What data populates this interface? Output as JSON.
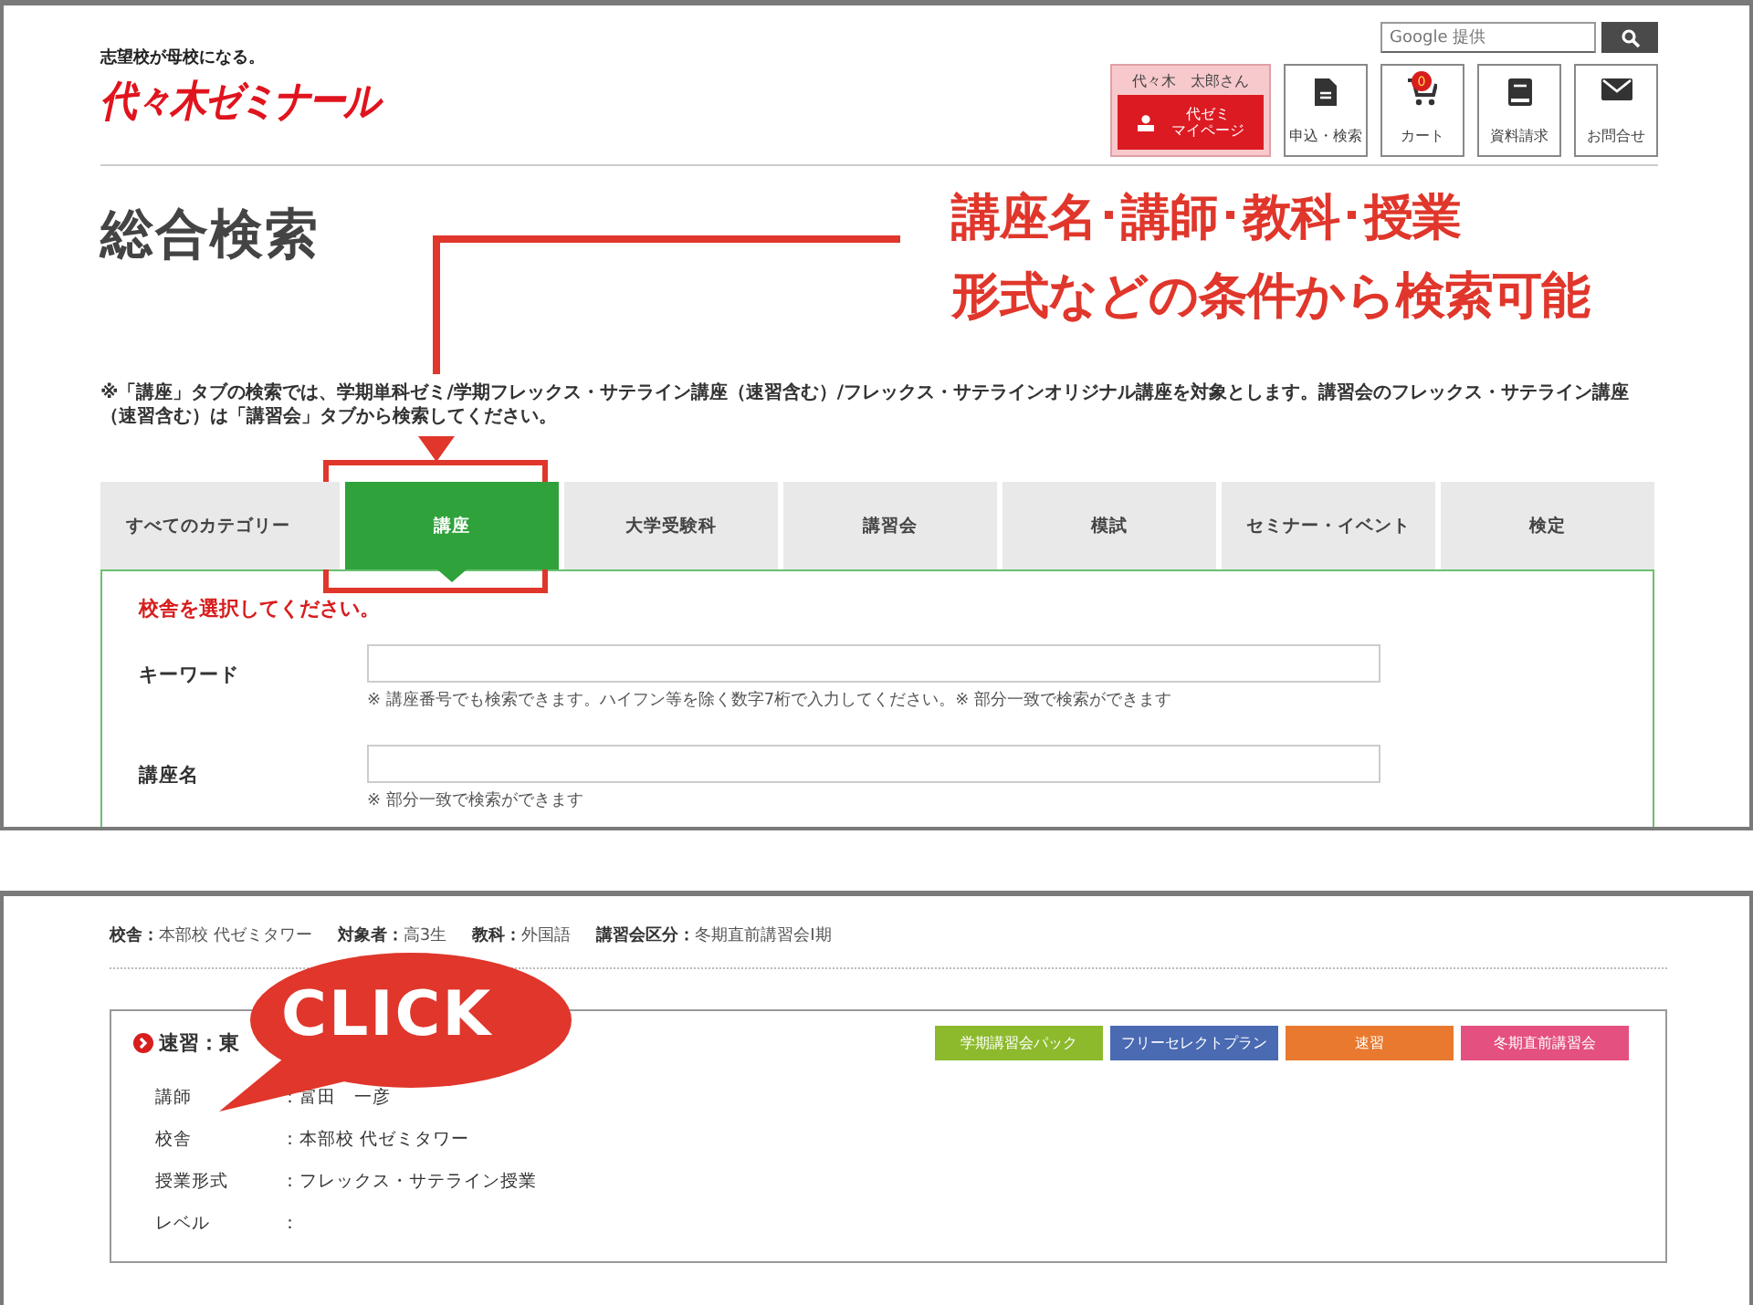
{
  "header": {
    "tagline": "志望校が母校になる。",
    "logo": "代々木ゼミナール",
    "search": {
      "placeholder": "Google 提供"
    },
    "user": {
      "name": "代々木　太郎さん",
      "mypage": [
        "代ゼミ",
        "マイページ"
      ]
    },
    "nav": [
      {
        "kind": "doc",
        "label": "申込・検索"
      },
      {
        "kind": "cart",
        "label": "カート",
        "badge": "0"
      },
      {
        "kind": "book",
        "label": "資料請求"
      },
      {
        "kind": "mail",
        "label": "お問合せ"
      }
    ]
  },
  "page_title": "総合検索",
  "annotation": {
    "lines": [
      "講座名･講師･教科･授業",
      "形式などの条件から検索可能"
    ],
    "click_label": "CLICK"
  },
  "notice": "※「講座」タブの検索では、学期単科ゼミ/学期フレックス・サテライン講座（速習含む）/フレックス・サテラインオリジナル講座を対象とします。講習会のフレックス・サテライン講座（速習含む）は「講習会」タブから検索してください。",
  "tabs": [
    {
      "label": "すべてのカテゴリー",
      "selected": false
    },
    {
      "label": "講座",
      "selected": true
    },
    {
      "label": "大学受験科",
      "selected": false
    },
    {
      "label": "講習会",
      "selected": false
    },
    {
      "label": "模試",
      "selected": false
    },
    {
      "label": "セミナー・イベント",
      "selected": false
    },
    {
      "label": "検定",
      "selected": false
    }
  ],
  "form": {
    "error": "校舎を選択してください。",
    "fields": [
      {
        "label": "キーワード",
        "hint": "※ 講座番号でも検索できます。ハイフン等を除く数字7桁で入力してください。※ 部分一致で検索ができます"
      },
      {
        "label": "講座名",
        "hint": "※ 部分一致で検索ができます"
      }
    ]
  },
  "result": {
    "meta": [
      {
        "label": "校舎：",
        "value": "本部校 代ゼミタワー"
      },
      {
        "label": "対象者：",
        "value": "高3生"
      },
      {
        "label": "教科：",
        "value": "外国語"
      },
      {
        "label": "講習会区分：",
        "value": "冬期直前講習会Ⅰ期"
      }
    ],
    "course_title": "速習：東",
    "tags": [
      {
        "label": "学期講習会パック",
        "color": "#8cba2c"
      },
      {
        "label": "フリーセレクトプラン",
        "color": "#4a6ab2"
      },
      {
        "label": "速習",
        "color": "#e8792f"
      },
      {
        "label": "冬期直前講習会",
        "color": "#e4507f"
      }
    ],
    "details": [
      {
        "label": "講師",
        "value": "：富田　一彦"
      },
      {
        "label": "校舎",
        "value": "：本部校 代ゼミタワー"
      },
      {
        "label": "授業形式",
        "value": "：フレックス・サテライン授業"
      },
      {
        "label": "レベル",
        "value": "："
      }
    ]
  }
}
